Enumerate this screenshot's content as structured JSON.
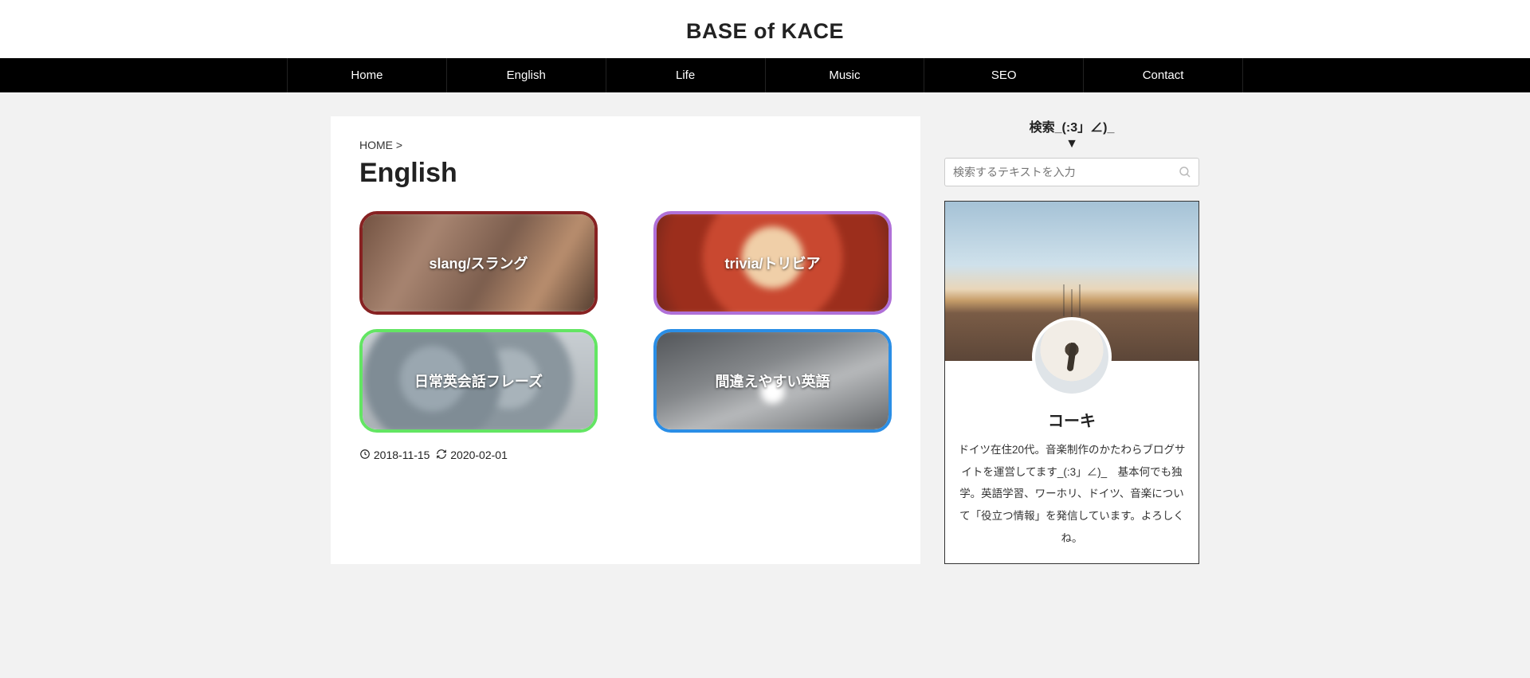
{
  "site": {
    "title": "BASE of KACE"
  },
  "nav": {
    "items": [
      {
        "label": "Home"
      },
      {
        "label": "English"
      },
      {
        "label": "Life"
      },
      {
        "label": "Music"
      },
      {
        "label": "SEO"
      },
      {
        "label": "Contact"
      }
    ]
  },
  "breadcrumb": {
    "home": "HOME",
    "sep": " > "
  },
  "page": {
    "title": "English"
  },
  "categories": [
    {
      "label": "slang/スラング"
    },
    {
      "label": "trivia/トリビア"
    },
    {
      "label": "日常英会話フレーズ"
    },
    {
      "label": "間違えやすい英語"
    }
  ],
  "dates": {
    "published": "2018-11-15",
    "updated": "2020-02-01"
  },
  "sidebar": {
    "search_title": "検索_(:3」∠)_",
    "arrow": "▼",
    "search_placeholder": "検索するテキストを入力",
    "profile": {
      "name": "コーキ",
      "desc": "ドイツ在住20代。音楽制作のかたわらブログサイトを運営してます_(:3」∠)_　基本何でも独学。英語学習、ワーホリ、ドイツ、音楽について「役立つ情報」を発信しています。よろしくね。"
    }
  }
}
